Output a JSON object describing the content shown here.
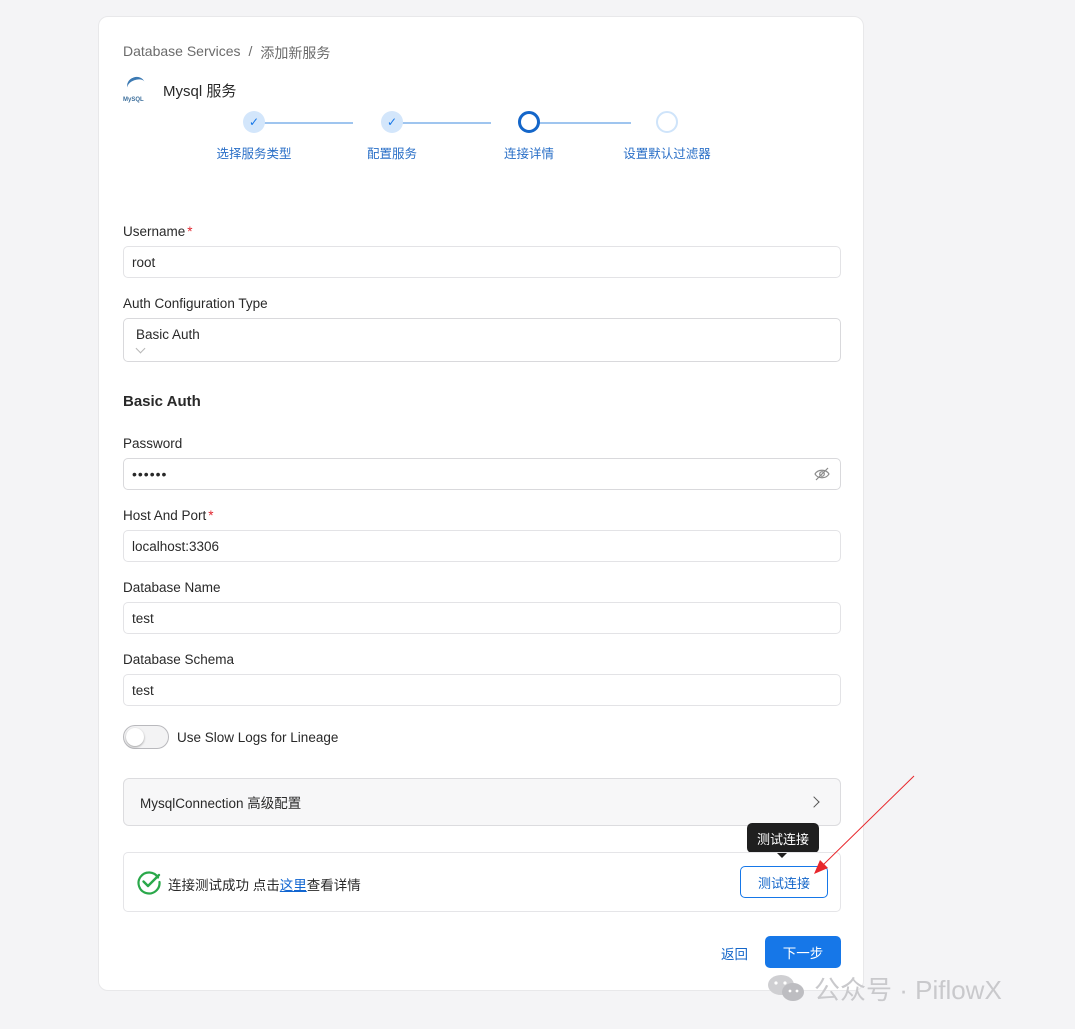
{
  "breadcrumb": {
    "root": "Database Services",
    "sep": "/",
    "current": "添加新服务"
  },
  "service": {
    "logo_text": "MySQL",
    "name": "Mysql 服务"
  },
  "steps": [
    {
      "label": "选择服务类型",
      "state": "done"
    },
    {
      "label": "配置服务",
      "state": "done"
    },
    {
      "label": "连接详情",
      "state": "active"
    },
    {
      "label": "设置默认过滤器",
      "state": "todo"
    }
  ],
  "form": {
    "username": {
      "label": "Username",
      "required": "*",
      "value": "root"
    },
    "auth_type": {
      "label": "Auth Configuration Type",
      "value": "Basic Auth"
    },
    "section_title": "Basic Auth",
    "password": {
      "label": "Password",
      "value": "••••••"
    },
    "host_port": {
      "label": "Host And Port",
      "required": "*",
      "value": "localhost:3306"
    },
    "database_name": {
      "label": "Database Name",
      "value": "test"
    },
    "database_schema": {
      "label": "Database Schema",
      "value": "test"
    },
    "slow_logs": {
      "label": "Use Slow Logs for Lineage"
    },
    "advanced": {
      "label": "MysqlConnection 高级配置"
    }
  },
  "test": {
    "msg_prefix": "连接测试成功 点击",
    "link": "这里",
    "msg_suffix": "查看详情",
    "button": "测试连接",
    "tooltip": "测试连接"
  },
  "footer": {
    "back": "返回",
    "next": "下一步"
  },
  "watermark": {
    "text": "公众号 · PiflowX"
  },
  "colors": {
    "primary": "#1677e8",
    "success": "#2aa84a",
    "required": "#e0262f",
    "annotation": "#e8262b"
  }
}
